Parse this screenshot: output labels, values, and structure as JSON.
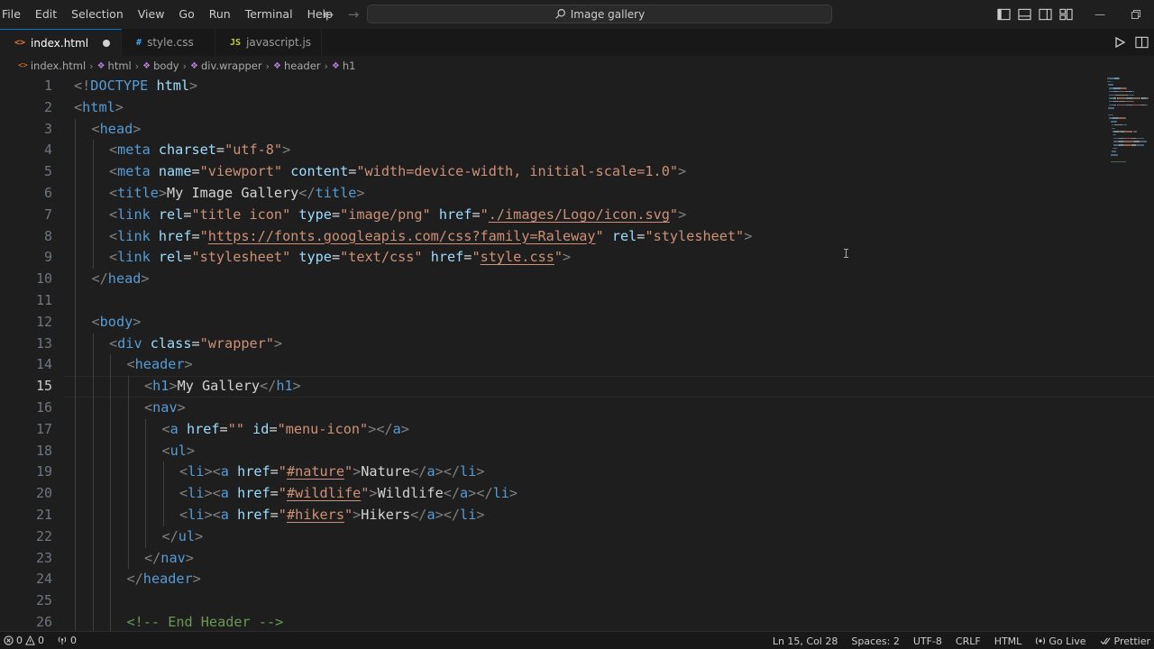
{
  "menu": [
    "File",
    "Edit",
    "Selection",
    "View",
    "Go",
    "Run",
    "Terminal",
    "Help"
  ],
  "search": {
    "label": "Image gallery"
  },
  "tabs": [
    {
      "label": "index.html",
      "icon": "html-icon",
      "active": true,
      "dirty": true
    },
    {
      "label": "style.css",
      "icon": "css-icon",
      "active": false,
      "dirty": false
    },
    {
      "label": "javascript.js",
      "icon": "js-icon",
      "active": false,
      "dirty": false
    }
  ],
  "breadcrumbs": [
    "index.html",
    "html",
    "body",
    "div.wrapper",
    "header",
    "h1"
  ],
  "editor": {
    "current_line": 15,
    "line_numbers": [
      "1",
      "2",
      "3",
      "4",
      "5",
      "6",
      "7",
      "8",
      "9",
      "10",
      "11",
      "12",
      "13",
      "14",
      "15",
      "16",
      "17",
      "18",
      "19",
      "20",
      "21",
      "22",
      "23",
      "24",
      "25",
      "26"
    ],
    "lines": [
      {
        "indent": 0,
        "tokens": [
          [
            "punct",
            "<!"
          ],
          [
            "tag",
            "DOCTYPE"
          ],
          [
            "text",
            " "
          ],
          [
            "attr",
            "html"
          ],
          [
            "punct",
            ">"
          ]
        ]
      },
      {
        "indent": 0,
        "tokens": [
          [
            "punct",
            "<"
          ],
          [
            "tag",
            "html"
          ],
          [
            "punct",
            ">"
          ]
        ]
      },
      {
        "indent": 1,
        "tokens": [
          [
            "punct",
            "<"
          ],
          [
            "tag",
            "head"
          ],
          [
            "punct",
            ">"
          ]
        ]
      },
      {
        "indent": 2,
        "tokens": [
          [
            "punct",
            "<"
          ],
          [
            "tag",
            "meta"
          ],
          [
            "text",
            " "
          ],
          [
            "attr",
            "charset"
          ],
          [
            "text",
            "="
          ],
          [
            "val",
            "\"utf-8\""
          ],
          [
            "punct",
            ">"
          ]
        ]
      },
      {
        "indent": 2,
        "tokens": [
          [
            "punct",
            "<"
          ],
          [
            "tag",
            "meta"
          ],
          [
            "text",
            " "
          ],
          [
            "attr",
            "name"
          ],
          [
            "text",
            "="
          ],
          [
            "val",
            "\"viewport\""
          ],
          [
            "text",
            " "
          ],
          [
            "attr",
            "content"
          ],
          [
            "text",
            "="
          ],
          [
            "val",
            "\"width=device-width, initial-scale=1.0\""
          ],
          [
            "punct",
            ">"
          ]
        ]
      },
      {
        "indent": 2,
        "tokens": [
          [
            "punct",
            "<"
          ],
          [
            "tag",
            "title"
          ],
          [
            "punct",
            ">"
          ],
          [
            "text",
            "My Image Gallery"
          ],
          [
            "punct",
            "</"
          ],
          [
            "tag",
            "title"
          ],
          [
            "punct",
            ">"
          ]
        ]
      },
      {
        "indent": 2,
        "tokens": [
          [
            "punct",
            "<"
          ],
          [
            "tag",
            "link"
          ],
          [
            "text",
            " "
          ],
          [
            "attr",
            "rel"
          ],
          [
            "text",
            "="
          ],
          [
            "val",
            "\"title icon\""
          ],
          [
            "text",
            " "
          ],
          [
            "attr",
            "type"
          ],
          [
            "text",
            "="
          ],
          [
            "val",
            "\"image/png\""
          ],
          [
            "text",
            " "
          ],
          [
            "attr",
            "href"
          ],
          [
            "text",
            "="
          ],
          [
            "val",
            "\""
          ],
          [
            "link",
            "./images/Logo/icon.svg"
          ],
          [
            "val",
            "\""
          ],
          [
            "punct",
            ">"
          ]
        ]
      },
      {
        "indent": 2,
        "tokens": [
          [
            "punct",
            "<"
          ],
          [
            "tag",
            "link"
          ],
          [
            "text",
            " "
          ],
          [
            "attr",
            "href"
          ],
          [
            "text",
            "="
          ],
          [
            "val",
            "\""
          ],
          [
            "link",
            "https://fonts.googleapis.com/css?family=Raleway"
          ],
          [
            "val",
            "\""
          ],
          [
            "text",
            " "
          ],
          [
            "attr",
            "rel"
          ],
          [
            "text",
            "="
          ],
          [
            "val",
            "\"stylesheet\""
          ],
          [
            "punct",
            ">"
          ]
        ]
      },
      {
        "indent": 2,
        "tokens": [
          [
            "punct",
            "<"
          ],
          [
            "tag",
            "link"
          ],
          [
            "text",
            " "
          ],
          [
            "attr",
            "rel"
          ],
          [
            "text",
            "="
          ],
          [
            "val",
            "\"stylesheet\""
          ],
          [
            "text",
            " "
          ],
          [
            "attr",
            "type"
          ],
          [
            "text",
            "="
          ],
          [
            "val",
            "\"text/css\""
          ],
          [
            "text",
            " "
          ],
          [
            "attr",
            "href"
          ],
          [
            "text",
            "="
          ],
          [
            "val",
            "\""
          ],
          [
            "link",
            "style.css"
          ],
          [
            "val",
            "\""
          ],
          [
            "punct",
            ">"
          ]
        ]
      },
      {
        "indent": 1,
        "tokens": [
          [
            "punct",
            "</"
          ],
          [
            "tag",
            "head"
          ],
          [
            "punct",
            ">"
          ]
        ]
      },
      {
        "indent": 0,
        "tokens": []
      },
      {
        "indent": 1,
        "tokens": [
          [
            "punct",
            "<"
          ],
          [
            "tag",
            "body"
          ],
          [
            "punct",
            ">"
          ]
        ]
      },
      {
        "indent": 2,
        "tokens": [
          [
            "punct",
            "<"
          ],
          [
            "tag",
            "div"
          ],
          [
            "text",
            " "
          ],
          [
            "attr",
            "class"
          ],
          [
            "text",
            "="
          ],
          [
            "val",
            "\"wrapper\""
          ],
          [
            "punct",
            ">"
          ]
        ]
      },
      {
        "indent": 3,
        "tokens": [
          [
            "punct",
            "<"
          ],
          [
            "tag",
            "header"
          ],
          [
            "punct",
            ">"
          ]
        ]
      },
      {
        "indent": 4,
        "tokens": [
          [
            "punct",
            "<"
          ],
          [
            "tag",
            "h1"
          ],
          [
            "punct",
            ">"
          ],
          [
            "text",
            "My Gallery"
          ],
          [
            "punct",
            "</"
          ],
          [
            "tag",
            "h1"
          ],
          [
            "punct",
            ">"
          ]
        ]
      },
      {
        "indent": 4,
        "tokens": [
          [
            "punct",
            "<"
          ],
          [
            "tag",
            "nav"
          ],
          [
            "punct",
            ">"
          ]
        ]
      },
      {
        "indent": 5,
        "tokens": [
          [
            "punct",
            "<"
          ],
          [
            "tag",
            "a"
          ],
          [
            "text",
            " "
          ],
          [
            "attr",
            "href"
          ],
          [
            "text",
            "="
          ],
          [
            "val",
            "\"\""
          ],
          [
            "text",
            " "
          ],
          [
            "attr",
            "id"
          ],
          [
            "text",
            "="
          ],
          [
            "val",
            "\"menu-icon\""
          ],
          [
            "punct",
            "></"
          ],
          [
            "tag",
            "a"
          ],
          [
            "punct",
            ">"
          ]
        ]
      },
      {
        "indent": 5,
        "tokens": [
          [
            "punct",
            "<"
          ],
          [
            "tag",
            "ul"
          ],
          [
            "punct",
            ">"
          ]
        ]
      },
      {
        "indent": 6,
        "tokens": [
          [
            "punct",
            "<"
          ],
          [
            "tag",
            "li"
          ],
          [
            "punct",
            "><"
          ],
          [
            "tag",
            "a"
          ],
          [
            "text",
            " "
          ],
          [
            "attr",
            "href"
          ],
          [
            "text",
            "="
          ],
          [
            "val",
            "\""
          ],
          [
            "link",
            "#nature"
          ],
          [
            "val",
            "\""
          ],
          [
            "punct",
            ">"
          ],
          [
            "text",
            "Nature"
          ],
          [
            "punct",
            "</"
          ],
          [
            "tag",
            "a"
          ],
          [
            "punct",
            "></"
          ],
          [
            "tag",
            "li"
          ],
          [
            "punct",
            ">"
          ]
        ]
      },
      {
        "indent": 6,
        "tokens": [
          [
            "punct",
            "<"
          ],
          [
            "tag",
            "li"
          ],
          [
            "punct",
            "><"
          ],
          [
            "tag",
            "a"
          ],
          [
            "text",
            " "
          ],
          [
            "attr",
            "href"
          ],
          [
            "text",
            "="
          ],
          [
            "val",
            "\""
          ],
          [
            "link",
            "#wildlife"
          ],
          [
            "val",
            "\""
          ],
          [
            "punct",
            ">"
          ],
          [
            "text",
            "Wildlife"
          ],
          [
            "punct",
            "</"
          ],
          [
            "tag",
            "a"
          ],
          [
            "punct",
            "></"
          ],
          [
            "tag",
            "li"
          ],
          [
            "punct",
            ">"
          ]
        ]
      },
      {
        "indent": 6,
        "tokens": [
          [
            "punct",
            "<"
          ],
          [
            "tag",
            "li"
          ],
          [
            "punct",
            "><"
          ],
          [
            "tag",
            "a"
          ],
          [
            "text",
            " "
          ],
          [
            "attr",
            "href"
          ],
          [
            "text",
            "="
          ],
          [
            "val",
            "\""
          ],
          [
            "link",
            "#hikers"
          ],
          [
            "val",
            "\""
          ],
          [
            "punct",
            ">"
          ],
          [
            "text",
            "Hikers"
          ],
          [
            "punct",
            "</"
          ],
          [
            "tag",
            "a"
          ],
          [
            "punct",
            "></"
          ],
          [
            "tag",
            "li"
          ],
          [
            "punct",
            ">"
          ]
        ]
      },
      {
        "indent": 5,
        "tokens": [
          [
            "punct",
            "</"
          ],
          [
            "tag",
            "ul"
          ],
          [
            "punct",
            ">"
          ]
        ]
      },
      {
        "indent": 4,
        "tokens": [
          [
            "punct",
            "</"
          ],
          [
            "tag",
            "nav"
          ],
          [
            "punct",
            ">"
          ]
        ]
      },
      {
        "indent": 3,
        "tokens": [
          [
            "punct",
            "</"
          ],
          [
            "tag",
            "header"
          ],
          [
            "punct",
            ">"
          ]
        ]
      },
      {
        "indent": 0,
        "tokens": []
      },
      {
        "indent": 3,
        "tokens": [
          [
            "comment",
            "<!-- End Header -->"
          ]
        ]
      }
    ]
  },
  "status": {
    "errors": "0",
    "warnings": "0",
    "ports": "0",
    "position": "Ln 15, Col 28",
    "spaces": "Spaces: 2",
    "encoding": "UTF-8",
    "eol": "CRLF",
    "language": "HTML",
    "golive": "Go Live",
    "prettier": "Prettier"
  },
  "colors": {
    "accent": "#0078d4",
    "tag": "#569cd6",
    "attr": "#9cdcfe",
    "string": "#ce9178",
    "comment": "#6a9955"
  }
}
